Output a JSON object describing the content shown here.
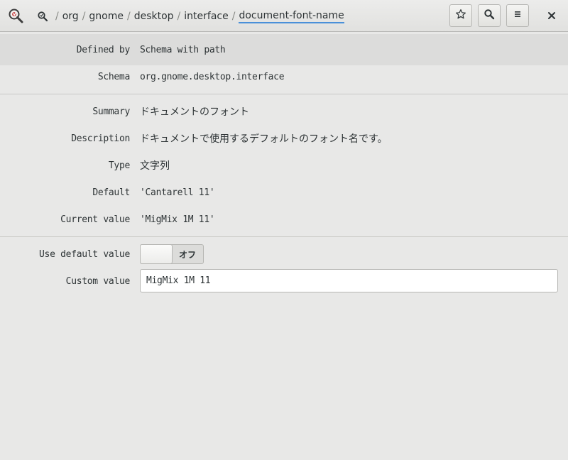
{
  "header": {
    "app_icon": "dconf-editor-icon",
    "path_root_icon": "search-path-icon",
    "path": [
      "org",
      "gnome",
      "desktop",
      "interface"
    ],
    "path_current": "document-font-name",
    "bookmark_icon": "star-icon",
    "search_icon": "search-icon",
    "menu_icon": "hamburger-menu-icon",
    "close_icon": "close-icon"
  },
  "properties": {
    "defined_by": {
      "label": "Defined by",
      "value": "Schema with path"
    },
    "schema": {
      "label": "Schema",
      "value": "org.gnome.desktop.interface"
    },
    "summary": {
      "label": "Summary",
      "value": "ドキュメントのフォント"
    },
    "description": {
      "label": "Description",
      "value": "ドキュメントで使用するデフォルトのフォント名です。"
    },
    "type": {
      "label": "Type",
      "value": "文字列"
    },
    "default": {
      "label": "Default",
      "value": "'Cantarell 11'"
    },
    "current_value": {
      "label": "Current value",
      "value": "'MigMix 1M 11'"
    }
  },
  "settings": {
    "use_default": {
      "label": "Use default value",
      "state_text": "オフ",
      "on": false
    },
    "custom_value": {
      "label": "Custom value",
      "value": "MigMix 1M 11"
    }
  },
  "colors": {
    "accent": "#4a90d9",
    "background": "#e8e8e7",
    "highlight_row": "#dcdcdb"
  }
}
